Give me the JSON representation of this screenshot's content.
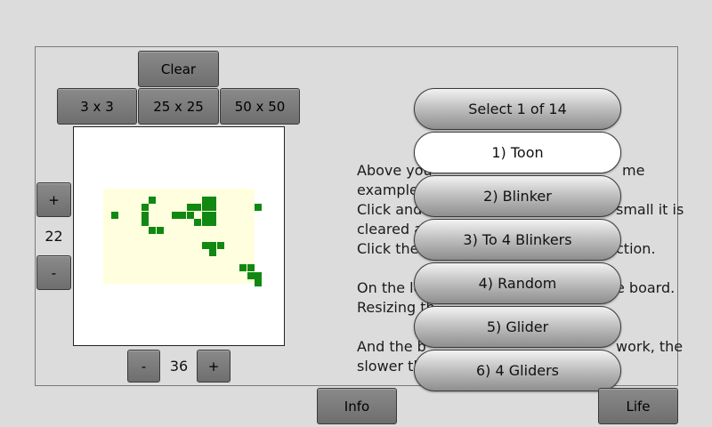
{
  "controls": {
    "clear_label": "Clear",
    "size_3_label": "3 x 3",
    "size_25_label": "25 x 25",
    "size_50_label": "50 x 50"
  },
  "rows": {
    "plus_label": "+",
    "value": "22",
    "minus_label": "-"
  },
  "cols": {
    "minus_label": "-",
    "value": "36",
    "plus_label": "+"
  },
  "colors": {
    "cell": "#118811",
    "board": "#ffffdf"
  },
  "info_text": [
    "Above you",
    "example",
    "Click and",
    "cleared a",
    "Click the",
    "",
    "On the le",
    "Resizing th",
    "",
    "And the b",
    "slower th"
  ],
  "info_text_right": [
    "me",
    "",
    "small it is",
    "",
    "ction.",
    "",
    "e board.",
    "",
    "",
    "work, the",
    ""
  ],
  "dropdown": {
    "title": "Select 1 of 14",
    "options": [
      "1) Toon",
      "2) Blinker",
      "3) To 4 Blinkers",
      "4) Random",
      "5) Glider",
      "6) 4 Gliders"
    ],
    "selected_index": 0
  },
  "bottom": {
    "info_label": "Info",
    "life_label": "Life"
  }
}
